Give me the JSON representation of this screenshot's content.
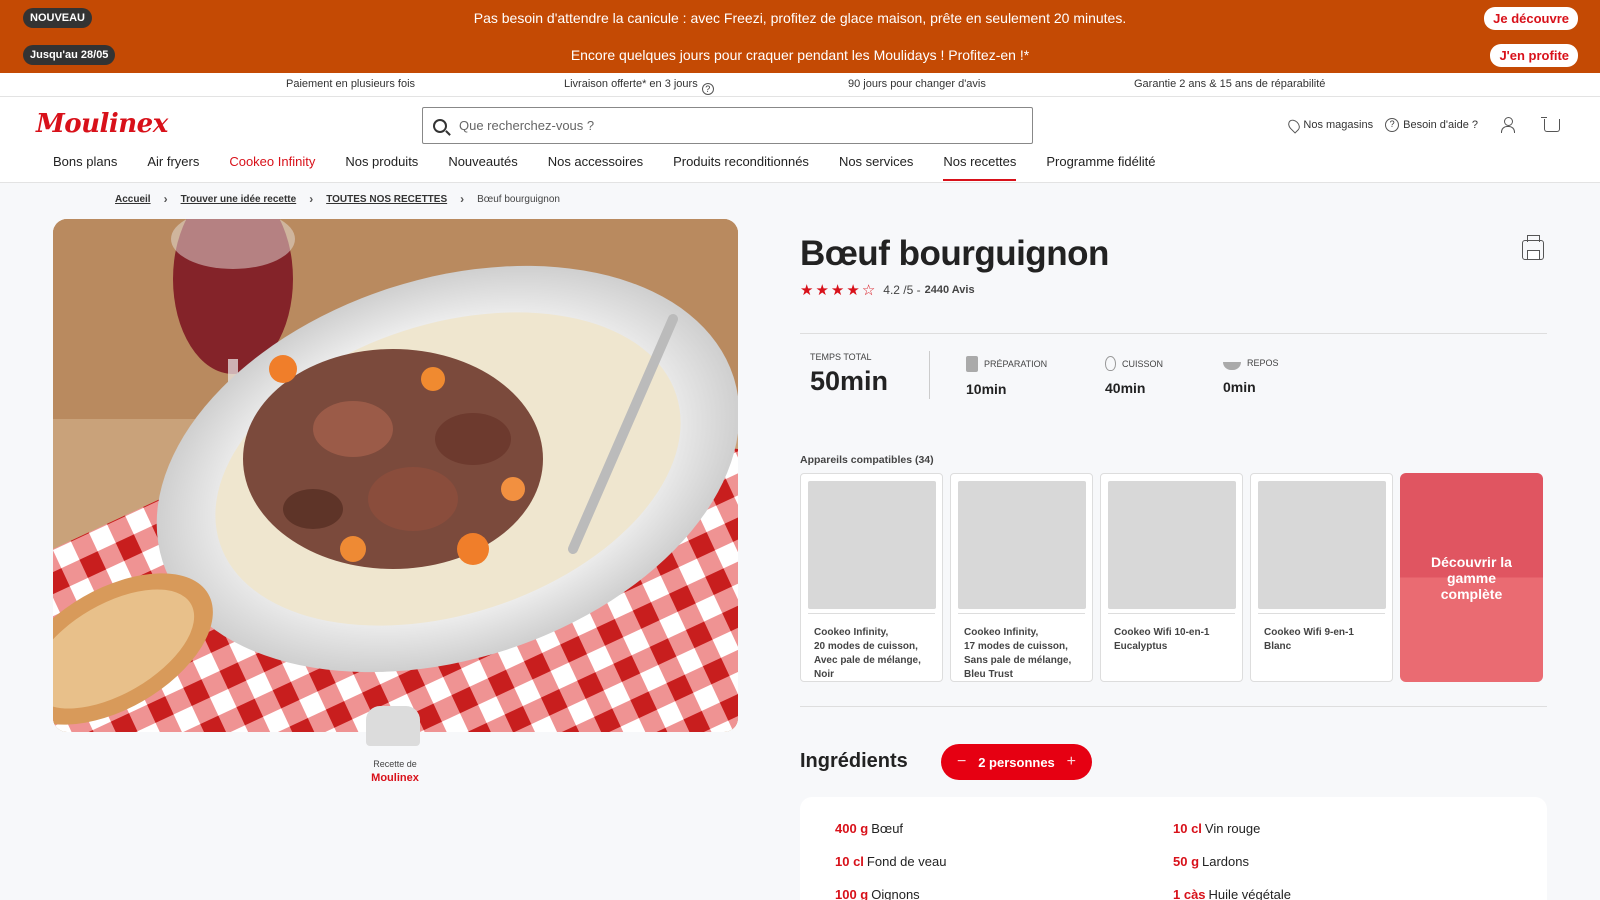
{
  "promo": {
    "row1": {
      "tag": "NOUVEAU",
      "text": "Pas besoin d'attendre la canicule : avec Freezi, profitez de glace maison, prête en seulement 20 minutes.",
      "cta": "Je découvre"
    },
    "row2": {
      "tag": "Jusqu'au 28/05",
      "text": "Encore quelques jours pour craquer pendant les Moulidays ! Profitez-en !*",
      "cta": "J'en profite"
    }
  },
  "reassurance": {
    "item1": "Paiement en plusieurs fois",
    "item2": "Livraison offerte* en 3 jours",
    "item3": "90 jours pour changer d'avis",
    "item4": "Garantie 2 ans & 15 ans de réparabilité"
  },
  "header": {
    "logo": "Moulinex",
    "search_placeholder": "Que recherchez-vous ?",
    "stores": "Nos magasins",
    "help": "Besoin d'aide ?"
  },
  "nav": [
    {
      "label": "Bons plans"
    },
    {
      "label": "Air fryers"
    },
    {
      "label": "Cookeo Infinity"
    },
    {
      "label": "Nos produits"
    },
    {
      "label": "Nouveautés"
    },
    {
      "label": "Nos accessoires"
    },
    {
      "label": "Produits reconditionnés"
    },
    {
      "label": "Nos services"
    },
    {
      "label": "Nos recettes"
    },
    {
      "label": "Programme fidélité"
    }
  ],
  "breadcrumb": {
    "home": "Accueil",
    "level2": "Trouver une idée recette",
    "level3": "TOUTES NOS RECETTES",
    "current": "Bœuf bourguignon"
  },
  "recipe": {
    "title": "Bœuf bourguignon",
    "rating_score": "4.2 /5 -",
    "rating_count": "2440 Avis",
    "stars": 4,
    "author_prefix": "Recette de",
    "author_brand": "Moulinex",
    "total_label": "TEMPS TOTAL",
    "total_value": "50min",
    "prep_label": "PRÉPARATION",
    "prep_value": "10min",
    "cook_label": "CUISSON",
    "cook_value": "40min",
    "rest_label": "REPOS",
    "rest_value": "0min"
  },
  "compatible": {
    "title": "Appareils compatibles (34)",
    "devices": [
      {
        "name": "Cookeo Infinity,\n20 modes de cuisson,\nAvec pale de mélange,\nNoir"
      },
      {
        "name": "Cookeo Infinity,\n17 modes de cuisson,\nSans pale de mélange,\nBleu Trust"
      },
      {
        "name": "Cookeo Wifi 10-en-1\nEucalyptus"
      },
      {
        "name": "Cookeo Wifi 9-en-1\nBlanc"
      }
    ],
    "cta": "Découvrir la gamme complète"
  },
  "ingredients": {
    "title": "Ingrédients",
    "people": "2 personnes",
    "items": [
      {
        "qty": "400 g",
        "name": "Bœuf"
      },
      {
        "qty": "10 cl",
        "name": "Vin rouge"
      },
      {
        "qty": "10 cl",
        "name": "Fond de veau"
      },
      {
        "qty": "50 g",
        "name": "Lardons"
      },
      {
        "qty": "100 g",
        "name": "Oignons"
      },
      {
        "qty": "1 càs",
        "name": "Huile végétale"
      }
    ]
  },
  "colors": {
    "brand_red": "#d8111a",
    "promo_bg": "#c44a04",
    "cta_card": "#e05561"
  }
}
